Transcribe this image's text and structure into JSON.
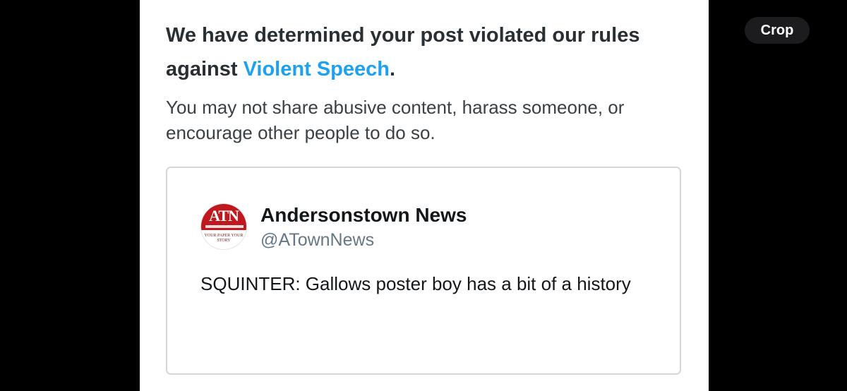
{
  "notice": {
    "heading_before": "We have determined your post violated our rules against ",
    "heading_link": "Violent Speech",
    "heading_after": ".",
    "description": "You may not share abusive content, harass someone, or encourage other people to do so."
  },
  "tweet": {
    "avatar_text": "ATN",
    "avatar_tagline": "YOUR PAPER YOUR STORY",
    "display_name": "Andersonstown News",
    "handle": "@ATownNews",
    "text": "SQUINTER: Gallows poster boy has a bit of a history"
  },
  "toolbar": {
    "crop_label": "Crop"
  },
  "colors": {
    "link": "#1da1f2",
    "background": "#000000",
    "card": "#ffffff",
    "avatar_red": "#c0181f"
  }
}
